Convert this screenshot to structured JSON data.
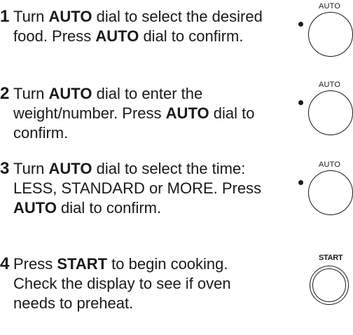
{
  "steps": [
    {
      "number": "1",
      "segments": [
        {
          "text": "Turn ",
          "bold": false
        },
        {
          "text": "AUTO",
          "bold": true
        },
        {
          "text": " dial to select the desired food. Press ",
          "bold": false
        },
        {
          "text": "AUTO",
          "bold": true
        },
        {
          "text": " dial to confirm.",
          "bold": false
        }
      ]
    },
    {
      "number": "2",
      "segments": [
        {
          "text": "Turn ",
          "bold": false
        },
        {
          "text": "AUTO",
          "bold": true
        },
        {
          "text": " dial to enter the weight/number. Press ",
          "bold": false
        },
        {
          "text": "AUTO",
          "bold": true
        },
        {
          "text": " dial to confirm.",
          "bold": false
        }
      ]
    },
    {
      "number": "3",
      "segments": [
        {
          "text": "Turn ",
          "bold": false
        },
        {
          "text": "AUTO",
          "bold": true
        },
        {
          "text": " dial to select the time: LESS, STANDARD or MORE. Press ",
          "bold": false
        },
        {
          "text": "AUTO",
          "bold": true
        },
        {
          "text": " dial to confirm.",
          "bold": false
        }
      ]
    },
    {
      "number": "4",
      "segments": [
        {
          "text": "Press ",
          "bold": false
        },
        {
          "text": "START",
          "bold": true
        },
        {
          "text": " to begin cooking. Check the display to see if oven needs to preheat.",
          "bold": false
        }
      ]
    }
  ],
  "dials": {
    "auto_label": "AUTO",
    "start_label": "START"
  }
}
